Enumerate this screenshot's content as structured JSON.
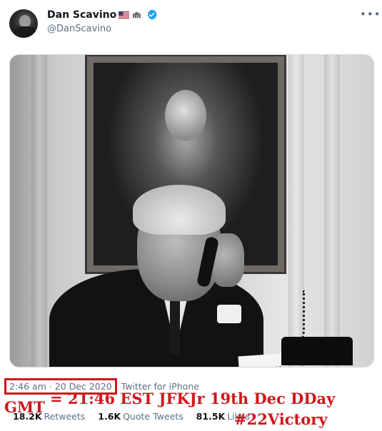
{
  "author": {
    "display_name": "Dan Scavino",
    "handle": "@DanScavino",
    "verified": true
  },
  "menu": {
    "more_glyph": "•••"
  },
  "tweet": {
    "timestamp": "2:46 am · 20 Dec 2020",
    "source": "Twitter for iPhone"
  },
  "stats": {
    "retweets": {
      "count": "18.2K",
      "label": "Retweets"
    },
    "quote_tweets": {
      "count": "1.6K",
      "label": "Quote Tweets"
    },
    "likes": {
      "count": "81.5K",
      "label": "Likes"
    }
  },
  "annotation": {
    "gmt": "GMT",
    "line": "= 21:46 EST JFKJr 19th Dec DDay",
    "tag": "#22Victory",
    "color": "#d0161a"
  },
  "colors": {
    "verified": "#1da1f2",
    "secondary_text": "#5b7083"
  }
}
